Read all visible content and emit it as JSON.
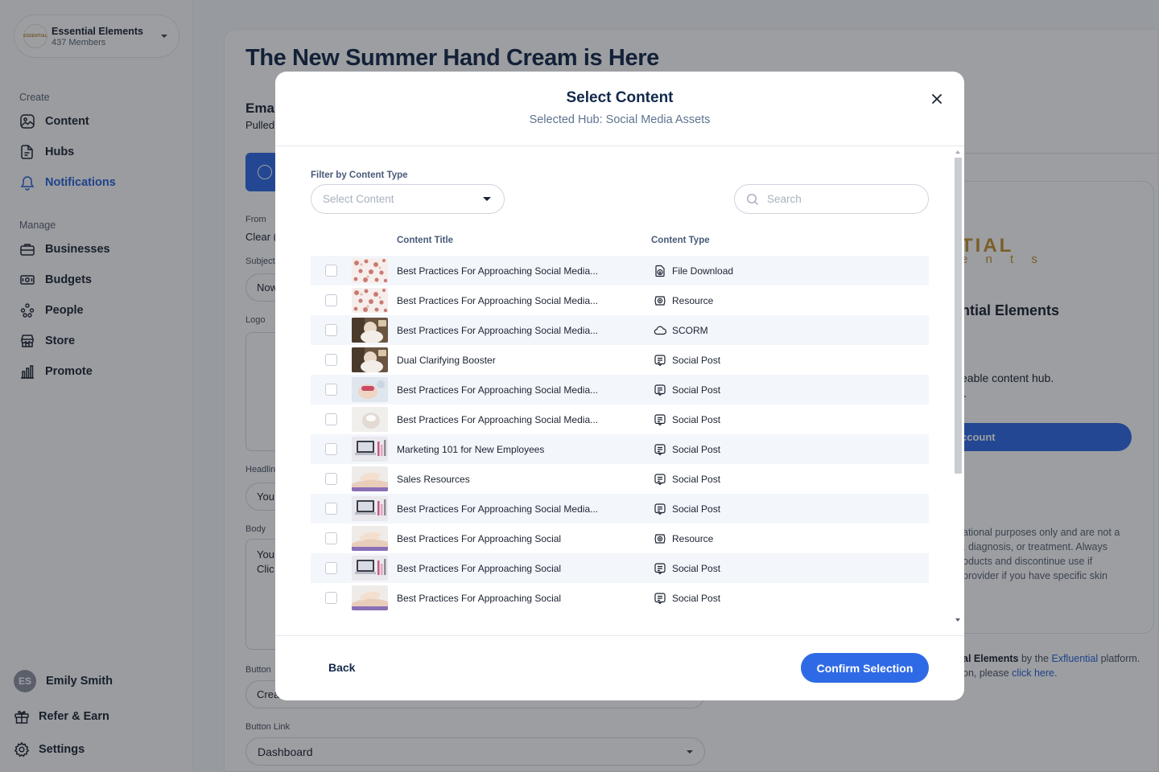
{
  "org": {
    "name": "Essential Elements",
    "members": "437 Members",
    "logo_text": "ESSENTIAL"
  },
  "sidebar": {
    "create_label": "Create",
    "create_items": [
      {
        "label": "Content",
        "icon": "image-icon"
      },
      {
        "label": "Hubs",
        "icon": "file-icon"
      },
      {
        "label": "Notifications",
        "icon": "bell-icon",
        "active": true
      }
    ],
    "manage_label": "Manage",
    "manage_items": [
      {
        "label": "Businesses",
        "icon": "briefcase-icon"
      },
      {
        "label": "Budgets",
        "icon": "money-icon"
      },
      {
        "label": "People",
        "icon": "people-icon"
      },
      {
        "label": "Store",
        "icon": "store-icon"
      },
      {
        "label": "Promote",
        "icon": "chart-icon"
      }
    ],
    "user": {
      "initials": "ES",
      "name": "Emily Smith"
    },
    "footer_items": [
      {
        "label": "Refer & Earn",
        "icon": "gift-icon"
      },
      {
        "label": "Settings",
        "icon": "gear-icon"
      }
    ]
  },
  "page": {
    "title": "The New Summer Hand Cream is Here",
    "section_title": "Emai",
    "section_sub": "Pulled",
    "from_label": "From",
    "from_value": "Clear (",
    "subject_label": "Subject",
    "subject_value": "Now",
    "logo_label": "Logo",
    "headline_label": "Headlin",
    "headline_value": "You",
    "body_label": "Body",
    "body_line1": "You",
    "body_line2": "Clic",
    "button_label": "Button",
    "button_value": "Crea",
    "button_link_label": "Button Link",
    "button_link_value": "Dashboard"
  },
  "preview": {
    "brand_line1": "TIAL",
    "brand_line2": "e n t s",
    "heading": "ntial Elements",
    "text1": "eable content hub.",
    "text2": "l.",
    "button": "ccount",
    "disc1": "ational purposes only and are not a",
    "disc2": ", diagnosis, or treatment. Always",
    "disc3": "oducts and discontinue use if",
    "disc4": "provider if you have specific skin",
    "footer_bold": "al Elements",
    "footer_mid": " by the ",
    "footer_link": "Exfluential",
    "footer_end": " platform.",
    "footer_line2": "on, please ",
    "footer_link2": "click here",
    "footer_dot": "."
  },
  "modal": {
    "title": "Select Content",
    "subtitle": "Selected Hub: Social Media Assets",
    "filter_label": "Filter by Content Type",
    "filter_placeholder": "Select Content",
    "search_placeholder": "Search",
    "col_title": "Content Title",
    "col_type": "Content Type",
    "rows": [
      {
        "title": "Best Practices For Approaching Social Media...",
        "type": "File Download",
        "icon": "file-download-icon",
        "thumb": "floral"
      },
      {
        "title": "Best Practices For Approaching Social Media...",
        "type": "Resource",
        "icon": "resource-icon",
        "thumb": "floral"
      },
      {
        "title": "Best Practices For Approaching Social Media...",
        "type": "SCORM",
        "icon": "cloud-icon",
        "thumb": "spa"
      },
      {
        "title": "Dual Clarifying Booster",
        "type": "Social Post",
        "icon": "social-post-icon",
        "thumb": "spa"
      },
      {
        "title": "Best Practices For Approaching Social Media...",
        "type": "Social Post",
        "icon": "social-post-icon",
        "thumb": "facial"
      },
      {
        "title": "Best Practices For Approaching Social Media...",
        "type": "Social Post",
        "icon": "social-post-icon",
        "thumb": "cream"
      },
      {
        "title": "Marketing 101 for New Employees",
        "type": "Social Post",
        "icon": "social-post-icon",
        "thumb": "laptop"
      },
      {
        "title": "Sales Resources",
        "type": "Social Post",
        "icon": "social-post-icon",
        "thumb": "massage"
      },
      {
        "title": "Best Practices For Approaching Social Media...",
        "type": "Social Post",
        "icon": "social-post-icon",
        "thumb": "laptop"
      },
      {
        "title": "Best Practices For Approaching Social",
        "type": "Resource",
        "icon": "resource-icon",
        "thumb": "massage"
      },
      {
        "title": "Best Practices For Approaching Social",
        "type": "Social Post",
        "icon": "social-post-icon",
        "thumb": "laptop"
      },
      {
        "title": "Best Practices For Approaching Social",
        "type": "Social Post",
        "icon": "social-post-icon",
        "thumb": "massage"
      }
    ],
    "back_label": "Back",
    "confirm_label": "Confirm Selection"
  },
  "colors": {
    "accent": "#2f6ae6",
    "title": "#13294b",
    "row_alt": "#f3f6fb",
    "brand_gold": "#c69330"
  }
}
